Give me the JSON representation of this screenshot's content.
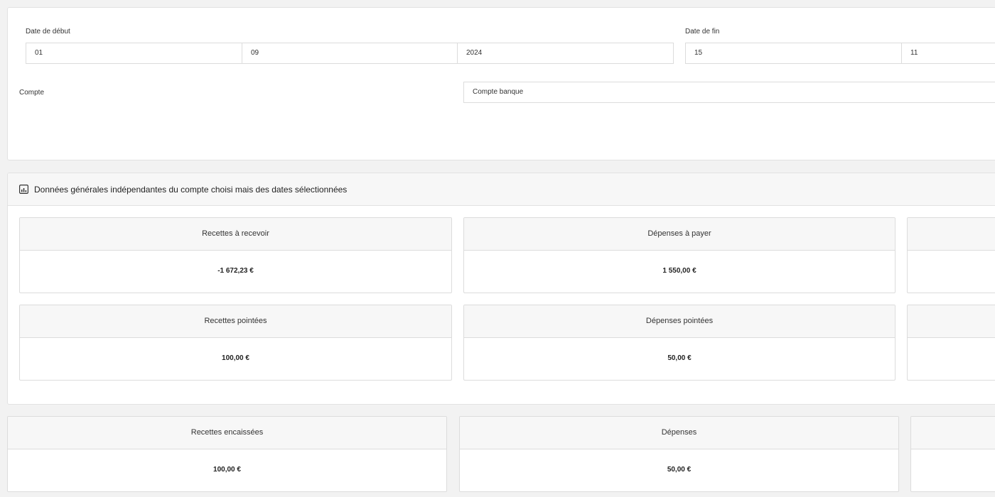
{
  "filters": {
    "start_label": "Date de début",
    "start_day": "01",
    "start_month": "09",
    "start_year": "2024",
    "end_label": "Date de fin",
    "end_day": "15",
    "end_month": "11",
    "account_label": "Compte",
    "account_value": "Compte banque"
  },
  "general": {
    "title": "Données générales indépendantes du compte choisi mais des dates sélectionnées",
    "cards": [
      {
        "label": "Recettes à recevoir",
        "value": "-1 672,23 €"
      },
      {
        "label": "Dépenses à payer",
        "value": "1 550,00 €"
      },
      {
        "label": "Recettes pointées",
        "value": "100,00 €"
      },
      {
        "label": "Dépenses pointées",
        "value": "50,00 €"
      }
    ]
  },
  "account": {
    "cards": [
      {
        "label": "Recettes encaissées",
        "value": "100,00 €"
      },
      {
        "label": "Dépenses",
        "value": "50,00 €"
      }
    ]
  }
}
